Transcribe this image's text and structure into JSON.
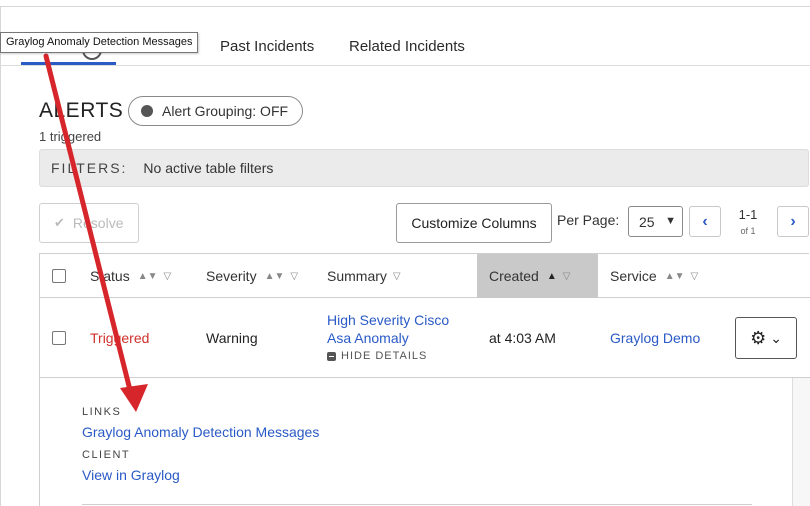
{
  "tooltip": {
    "text": "Graylog Anomaly Detection Messages"
  },
  "tabs": [
    {
      "label": "Past Incidents"
    },
    {
      "label": "Related Incidents"
    }
  ],
  "alerts": {
    "heading": "ALERTS",
    "grouping_label": "Alert Grouping: OFF",
    "triggered_count": "1 triggered"
  },
  "filters": {
    "label": "FILTERS:",
    "value": "No active table filters"
  },
  "toolbar": {
    "resolve_label": "Resolve",
    "customize_label": "Customize Columns",
    "per_page_label": "Per Page:",
    "per_page_value": "25",
    "page_range": "1-1",
    "page_of": "of 1"
  },
  "columns": [
    "Status",
    "Severity",
    "Summary",
    "Created",
    "Service"
  ],
  "row": {
    "status": "Triggered",
    "severity": "Warning",
    "summary_line1": "High Severity Cisco",
    "summary_line2": "Asa Anomaly",
    "hide_details": "HIDE DETAILS",
    "created": "at 4:03 AM",
    "service": "Graylog Demo"
  },
  "details": {
    "links_label": "LINKS",
    "links_value": "Graylog Anomaly Detection Messages",
    "client_label": "CLIENT",
    "client_value": "View in Graylog"
  },
  "colors": {
    "accent": "#2a5ac6",
    "triggered": "#d0302c",
    "arrow": "#d7262b"
  },
  "icons": {
    "check": "check-icon",
    "prev": "chevron-left-icon",
    "next": "chevron-right-icon",
    "gear": "gear-icon",
    "sort": "sort-icon",
    "filter": "filter-icon"
  }
}
